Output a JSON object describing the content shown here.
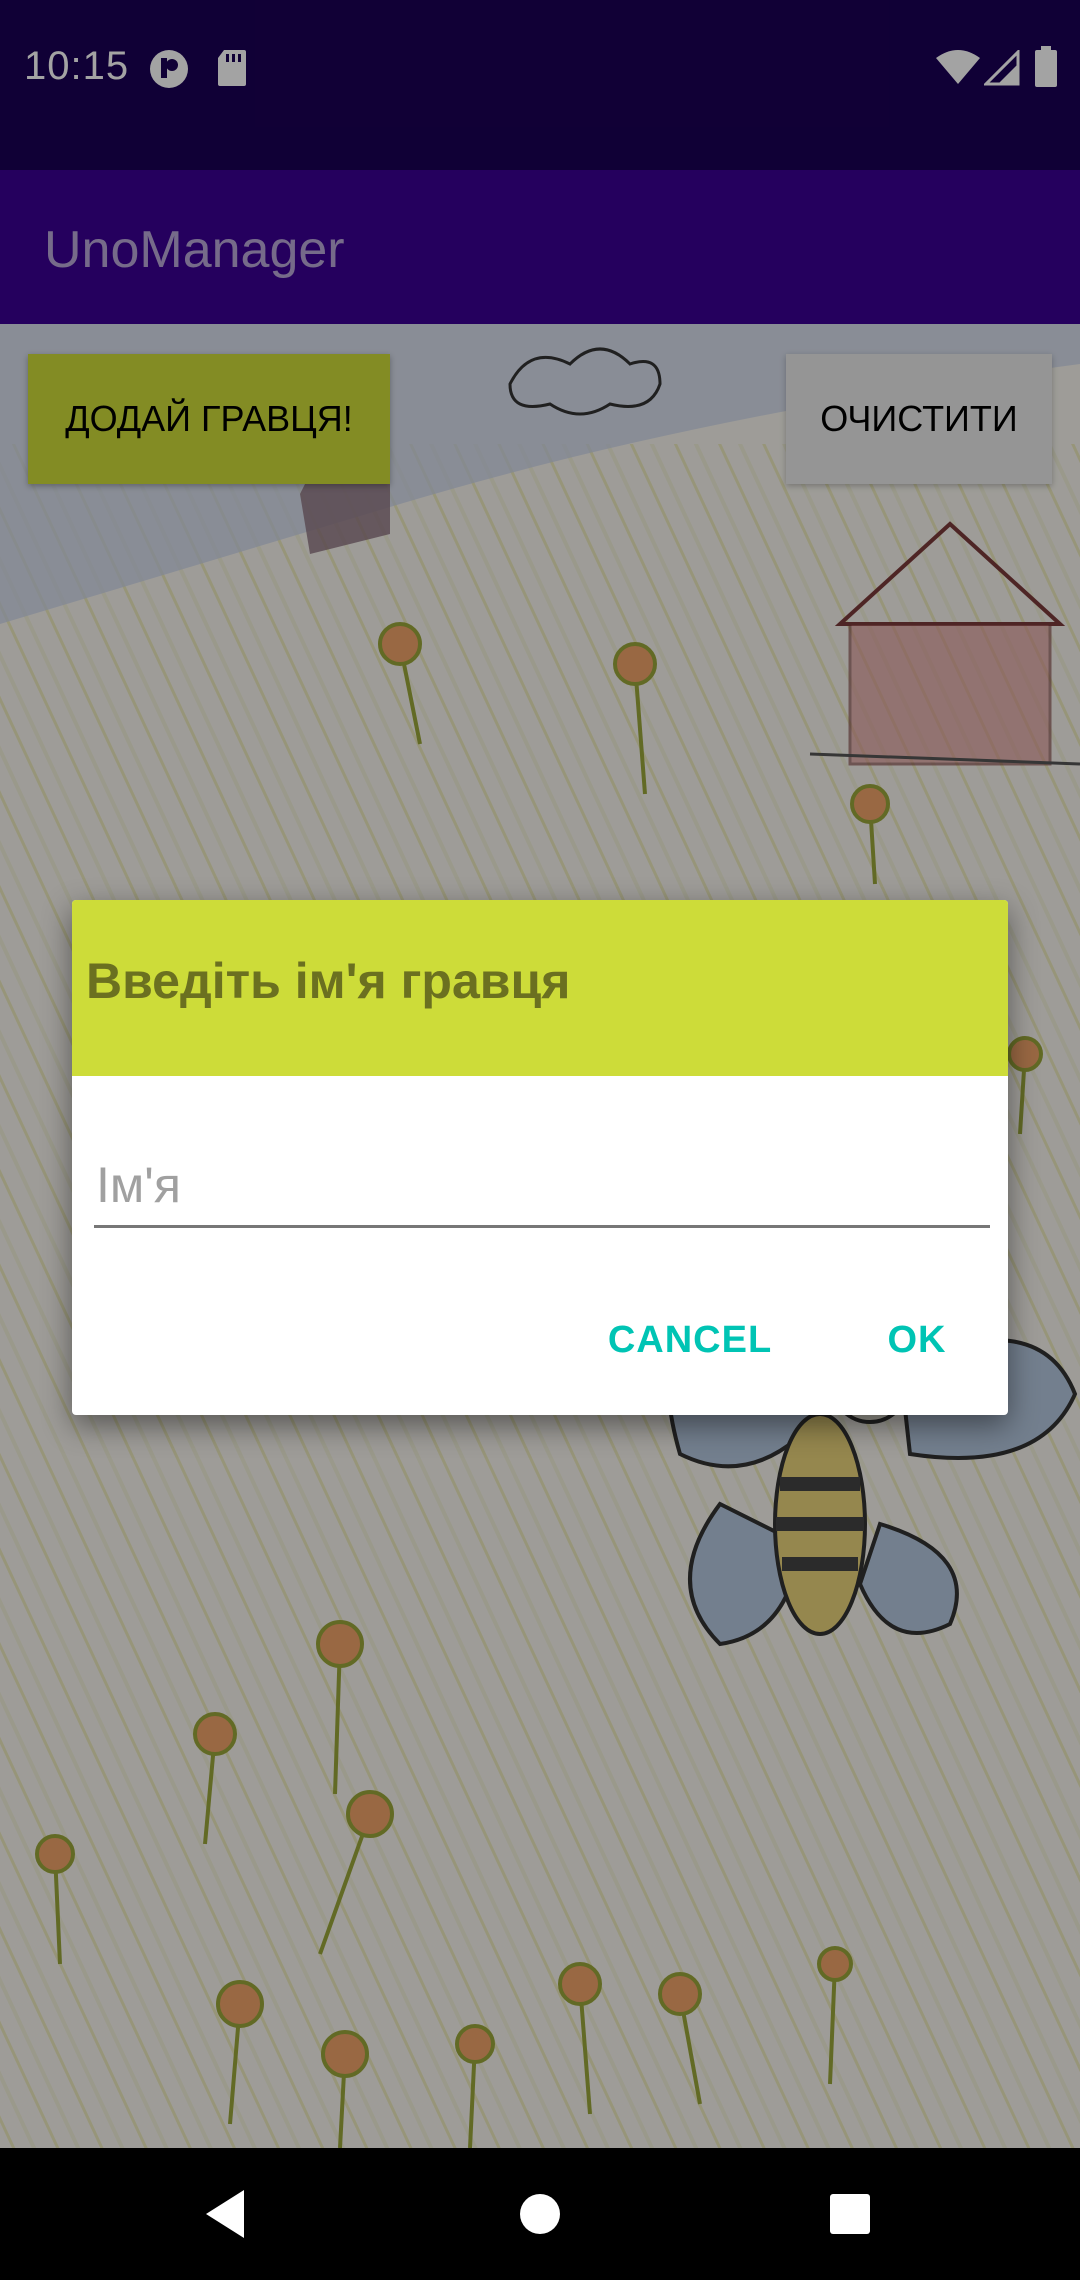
{
  "status_bar": {
    "time": "10:15",
    "left_icons": [
      "notification-icon",
      "sd-card-icon"
    ],
    "right_icons": [
      "wifi-icon",
      "cellular-signal-icon",
      "battery-icon"
    ]
  },
  "app_bar": {
    "title": "UnoManager",
    "background_color": "#3a0094"
  },
  "toolbar": {
    "add_player_label": "ДОДАЙ ГРАВЦЯ!",
    "clear_label": "ОЧИСТИТИ",
    "accent_color": "#cddc39"
  },
  "dialog": {
    "title": "Введіть ім'я гравця",
    "input_placeholder": "Ім'я",
    "input_value": "",
    "cancel_label": "CANCEL",
    "ok_label": "OK",
    "button_color": "#00c4b4"
  },
  "nav_bar": {
    "buttons": [
      "back-icon",
      "home-icon",
      "recents-icon"
    ]
  }
}
